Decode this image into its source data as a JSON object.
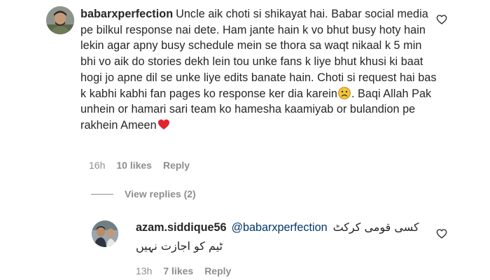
{
  "main_comment": {
    "username": "babarxperfection",
    "text_part1": "Uncle aik choti si shikayat hai. Babar social media pe bilkul response nai dete. Ham jante hain k vo bhut busy hoty hain lekin agar apny busy schedule mein se thora sa waqt nikaal k 5 min bhi vo aik do stories dekh lein tou unke fans k liye bhut khusi ki baat hogi jo apne dil se unke liye edits banate hain. Choti si request hai bas k kabhi kabhi fan pages ko response ker dia karein",
    "text_part2": ". Baqi Allah Pak unhein or hamari sari team ko hamesha kaamiyab or bulandion pe rakhein Ameen",
    "time": "16h",
    "likes": "10 likes",
    "reply_label": "Reply",
    "emoji_sad": "sad-face-emoji",
    "emoji_heart": "red-heart-emoji"
  },
  "view_replies": {
    "label": "View replies (2)"
  },
  "reply_comment": {
    "username": "azam.siddique56",
    "mention": "@babarxperfection",
    "urdu_line1": "کسی قومی کرکٹ",
    "urdu_line2": "ٹیم کو اجازت نہیں",
    "time": "13h",
    "likes": "7 likes",
    "reply_label": "Reply"
  },
  "icons": {
    "like": "heart-outline-icon"
  },
  "colors": {
    "text": "#262626",
    "secondary": "#8e8e8e",
    "mention": "#00376b",
    "heart": "#e0242e"
  }
}
